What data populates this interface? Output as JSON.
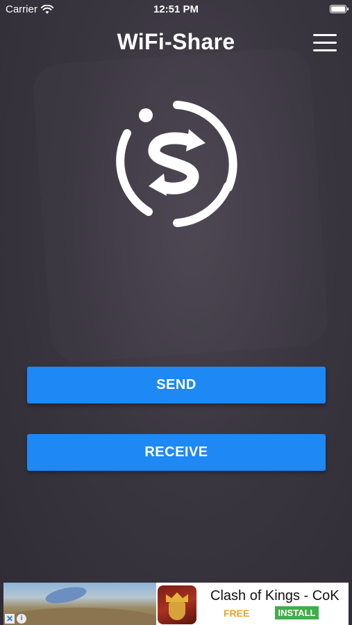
{
  "status_bar": {
    "carrier": "Carrier",
    "time": "12:51 PM",
    "icons": [
      "wifi-icon",
      "battery-icon"
    ]
  },
  "header": {
    "title": "WiFi-Share",
    "menu_icon": "hamburger-menu-icon"
  },
  "logo": {
    "icon": "wifi-share-logo-icon"
  },
  "actions": {
    "send_label": "SEND",
    "receive_label": "RECEIVE"
  },
  "ad": {
    "title": "Clash of Kings - CoK",
    "price": "FREE",
    "install_label": "INSTALL",
    "close_glyph": "✕",
    "info_glyph": "i"
  },
  "colors": {
    "button_blue": "#1e88f5",
    "install_green": "#3fae49",
    "free_orange": "#f0a020"
  }
}
